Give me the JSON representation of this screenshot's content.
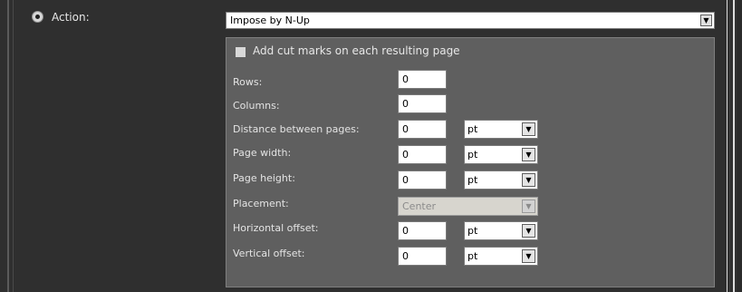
{
  "action": {
    "label": "Action:",
    "selected": "Impose by N-Up"
  },
  "cut_marks": {
    "label": "Add cut marks on each resulting page",
    "checked": false
  },
  "fields": {
    "rows": {
      "label": "Rows:",
      "value": "0"
    },
    "columns": {
      "label": "Columns:",
      "value": "0"
    },
    "distance": {
      "label": "Distance between pages:",
      "value": "0",
      "unit": "pt"
    },
    "page_width": {
      "label": "Page width:",
      "value": "0",
      "unit": "pt"
    },
    "page_height": {
      "label": "Page height:",
      "value": "0",
      "unit": "pt"
    },
    "placement": {
      "label": "Placement:",
      "value": "Center"
    },
    "horizontal_offset": {
      "label": "Horizontal offset:",
      "value": "0",
      "unit": "pt"
    },
    "vertical_offset": {
      "label": "Vertical offset:",
      "value": "0",
      "unit": "pt"
    }
  },
  "icons": {
    "dropdown": "chevron-down-icon",
    "radio": "radio-selected-icon",
    "checkbox": "checkbox-unchecked-icon"
  }
}
